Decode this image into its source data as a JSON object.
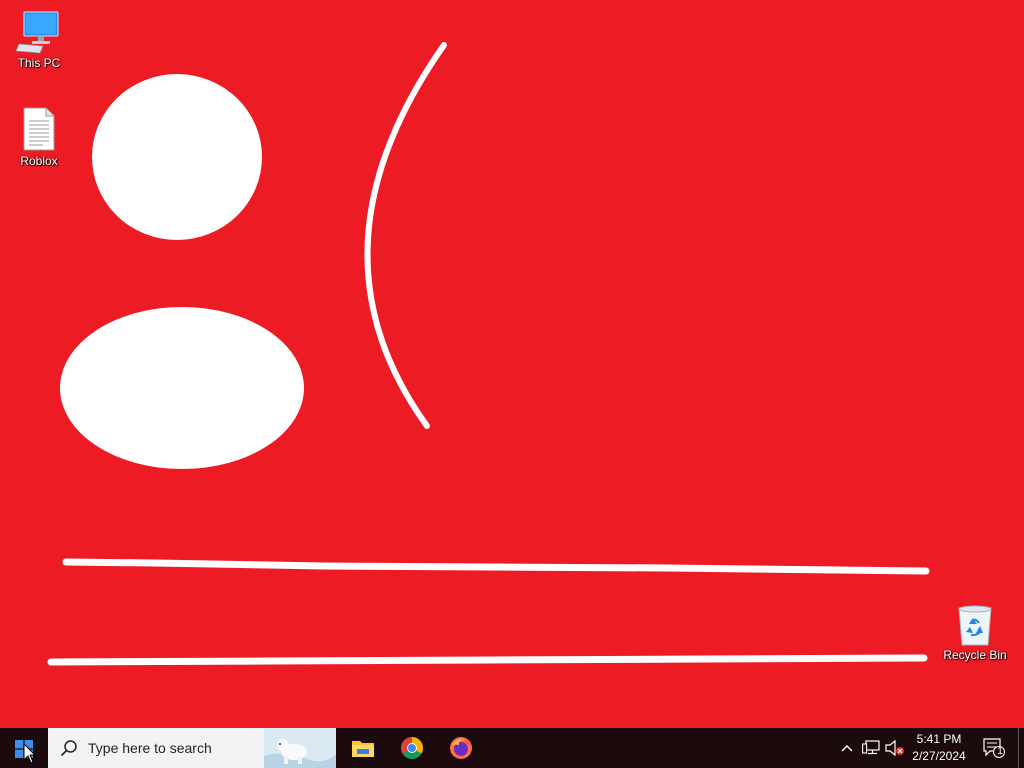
{
  "desktop": {
    "background_color": "#ED1C24",
    "icons": [
      {
        "label": "This PC",
        "icon": "computer-monitor-icon"
      },
      {
        "label": "Roblox",
        "icon": "text-document-icon"
      },
      {
        "label": "Recycle Bin",
        "icon": "recycle-bin-icon"
      }
    ],
    "wallpaper_drawing": [
      "white-circle",
      "white-ellipse",
      "white-curve",
      "white-line-upper",
      "white-line-lower"
    ]
  },
  "taskbar": {
    "start_icon": "windows-logo-icon",
    "search": {
      "placeholder": "Type here to search",
      "icon": "search-icon"
    },
    "pinned_apps": [
      {
        "name": "File Explorer",
        "icon": "file-explorer-icon"
      },
      {
        "name": "Google Chrome",
        "icon": "chrome-icon"
      },
      {
        "name": "Firefox",
        "icon": "firefox-icon"
      }
    ],
    "tray": {
      "icons": [
        "chevron-up-icon",
        "network-icon",
        "volume-muted-icon"
      ],
      "time": "5:41 PM",
      "date": "2/27/2024",
      "notification_count": "1"
    }
  }
}
